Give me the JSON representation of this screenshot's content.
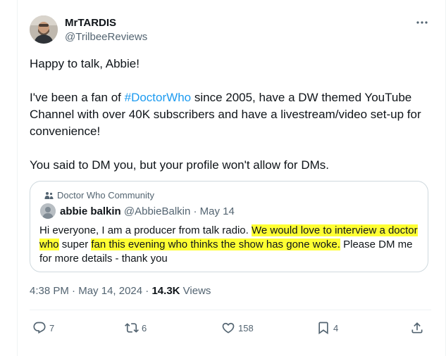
{
  "author": {
    "display_name": "MrTARDIS",
    "handle": "@TrilbeeReviews"
  },
  "tweet": {
    "line1": "Happy to talk, Abbie!",
    "para2_pre": "I've been a fan of ",
    "hashtag": "#DoctorWho",
    "para2_post": " since 2005, have a DW themed YouTube Channel with over 40K subscribers and have a livestream/video set-up for convenience!",
    "para3": "You said to DM you, but your profile won't allow for DMs."
  },
  "quote": {
    "community": "Doctor Who Community",
    "name": "abbie balkin",
    "handle": "@AbbieBalkin",
    "separator": "·",
    "date": "May 14",
    "text_plain1": "Hi everyone, I am a producer from talk radio. ",
    "text_hl1": "We would love to interview a doctor who",
    "text_plain2": " super ",
    "text_hl2": "fan this evening who thinks the show has gone woke.",
    "text_plain3": " Please DM me for more details - thank you"
  },
  "meta": {
    "time": "4:38 PM",
    "separator": "·",
    "date": "May 14, 2024",
    "dot": "·",
    "views_count": "14.3K",
    "views_label": "Views"
  },
  "actions": {
    "replies": "7",
    "reposts": "6",
    "likes": "158",
    "bookmarks": "4"
  },
  "colors": {
    "link": "#1d9bf0",
    "muted": "#536471",
    "highlight": "#ffff33"
  }
}
